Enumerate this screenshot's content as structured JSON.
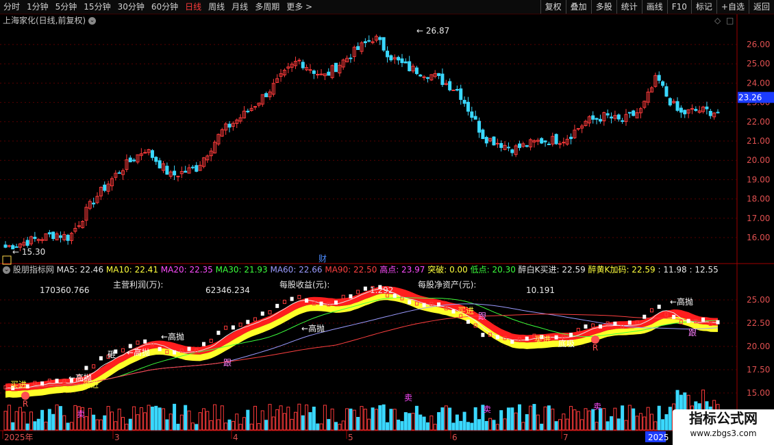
{
  "toolbar": {
    "tabs": [
      "分时",
      "1分钟",
      "5分钟",
      "15分钟",
      "30分钟",
      "60分钟",
      "日线",
      "周线",
      "月线",
      "多周期",
      "更多 >"
    ],
    "active_tab": "日线",
    "right_buttons": [
      "复权",
      "叠加",
      "多股",
      "统计",
      "画线",
      "F10",
      "标记",
      "+自选",
      "返回"
    ]
  },
  "main_chart": {
    "title": "上海家化(日线,前复权)",
    "high_label": "26.87",
    "low_label": "15.30",
    "current_price": "23.26",
    "financial_marker": "财",
    "y_ticks": [
      26,
      25,
      24,
      23,
      22,
      21,
      20,
      19,
      18,
      17,
      16
    ],
    "y_tick_labels": [
      "26.00",
      "25.00",
      "24.00",
      "23.00",
      "22.00",
      "21.00",
      "20.00",
      "19.00",
      "18.00",
      "17.00",
      "16.00"
    ]
  },
  "indicator": {
    "name": "股朋指标网",
    "items": [
      {
        "text": "MA5: 22.46",
        "color": "#e8e8e8"
      },
      {
        "text": "MA10: 22.41",
        "color": "#ffff3c"
      },
      {
        "text": "MA20: 22.35",
        "color": "#ff4cff"
      },
      {
        "text": "MA30: 21.93",
        "color": "#3cff3c"
      },
      {
        "text": "MA60: 22.66",
        "color": "#9b9bff"
      },
      {
        "text": "MA90: 22.50",
        "color": "#ff4040"
      },
      {
        "text": "高点: 23.97",
        "color": "#ff4cff"
      },
      {
        "text": "突破: 0.00",
        "color": "#ffff3c"
      },
      {
        "text": "低点: 20.30",
        "color": "#3cff3c"
      },
      {
        "text": "醉白K买进: 22.59",
        "color": "#e8e8e8"
      },
      {
        "text": "醉黄K加码: 22.59",
        "color": "#ffff3c"
      },
      {
        "text": ": 11.98",
        "color": "#e8e8e8"
      },
      {
        "text": ": 12.55",
        "color": "#e8e8e8"
      }
    ],
    "fundamentals": {
      "revenue_value": "170360.766",
      "profit_label": "主营利润(万):",
      "profit_value": "62346.234",
      "eps_label": "每股收益(元):",
      "eps_value": "1.292",
      "navps_label": "每股净资产(元):",
      "navps_value": "10.191"
    },
    "y_tick_labels": [
      "25.00",
      "22.50",
      "20.00",
      "17.50",
      "15.00"
    ],
    "signals": {
      "high_sell": "高抛",
      "buy": "买进",
      "follow": "跟",
      "sell": "卖",
      "smash": "砸",
      "bottom_suck": "底吸",
      "r": "R"
    }
  },
  "x_axis": {
    "labels": [
      "2025年",
      "3",
      "4",
      "5",
      "6",
      "7",
      "2025"
    ]
  },
  "watermark": {
    "title": "指标公式网",
    "url": "www.zbgs3.com"
  },
  "colors": {
    "up": "#ff3b3b",
    "down": "#3ad8ff",
    "grid": "#5a0000",
    "axis": "#a00000"
  }
}
